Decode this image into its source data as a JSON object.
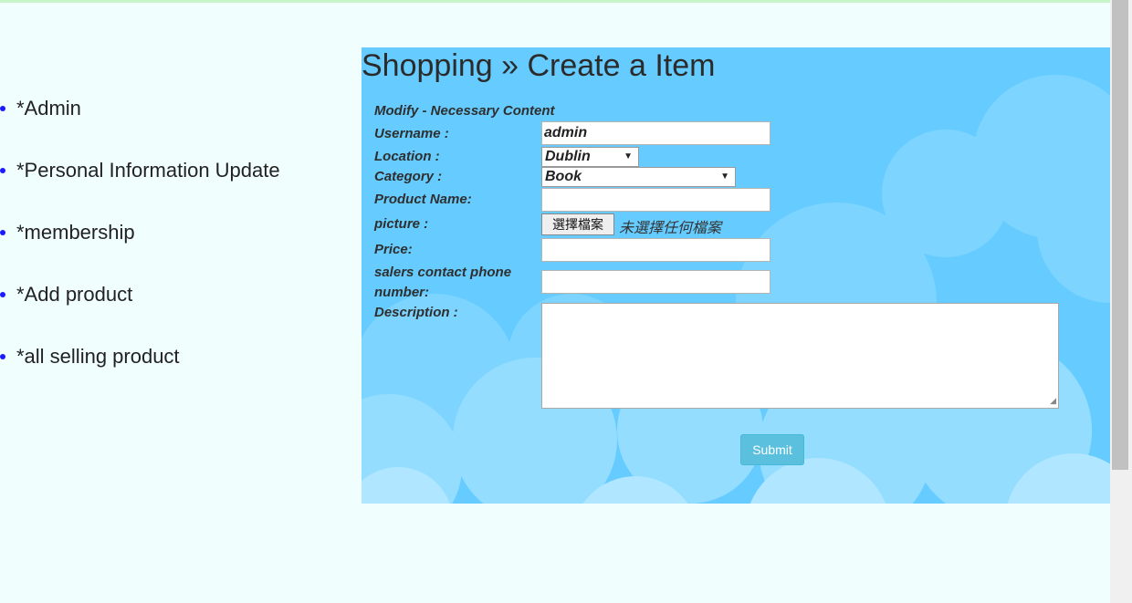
{
  "sidebar": {
    "items": [
      {
        "label": "*Admin"
      },
      {
        "label": "*Personal Information Update"
      },
      {
        "label": "*membership"
      },
      {
        "label": "*Add product"
      },
      {
        "label": "*all selling product"
      }
    ]
  },
  "page": {
    "title": "Shopping » Create a Item"
  },
  "form": {
    "section_heading": "Modify - Necessary Content",
    "username_label": "Username :",
    "username_value": "admin",
    "location_label": "Location :",
    "location_value": "Dublin",
    "category_label": "Category :",
    "category_value": "Book",
    "product_name_label": "Product Name:",
    "picture_label": "picture :",
    "file_button_label": "選擇檔案",
    "file_status": "未選擇任何檔案",
    "price_label": "Price:",
    "phone_label_line1": "salers contact phone",
    "phone_label_line2": "number:",
    "description_label": "Description :",
    "submit_label": "Submit"
  },
  "colors": {
    "page_background": "#f0fffe",
    "panel_background": "#66ccff",
    "submit_button": "#5bc0de",
    "bullet": "#1a1aff"
  }
}
